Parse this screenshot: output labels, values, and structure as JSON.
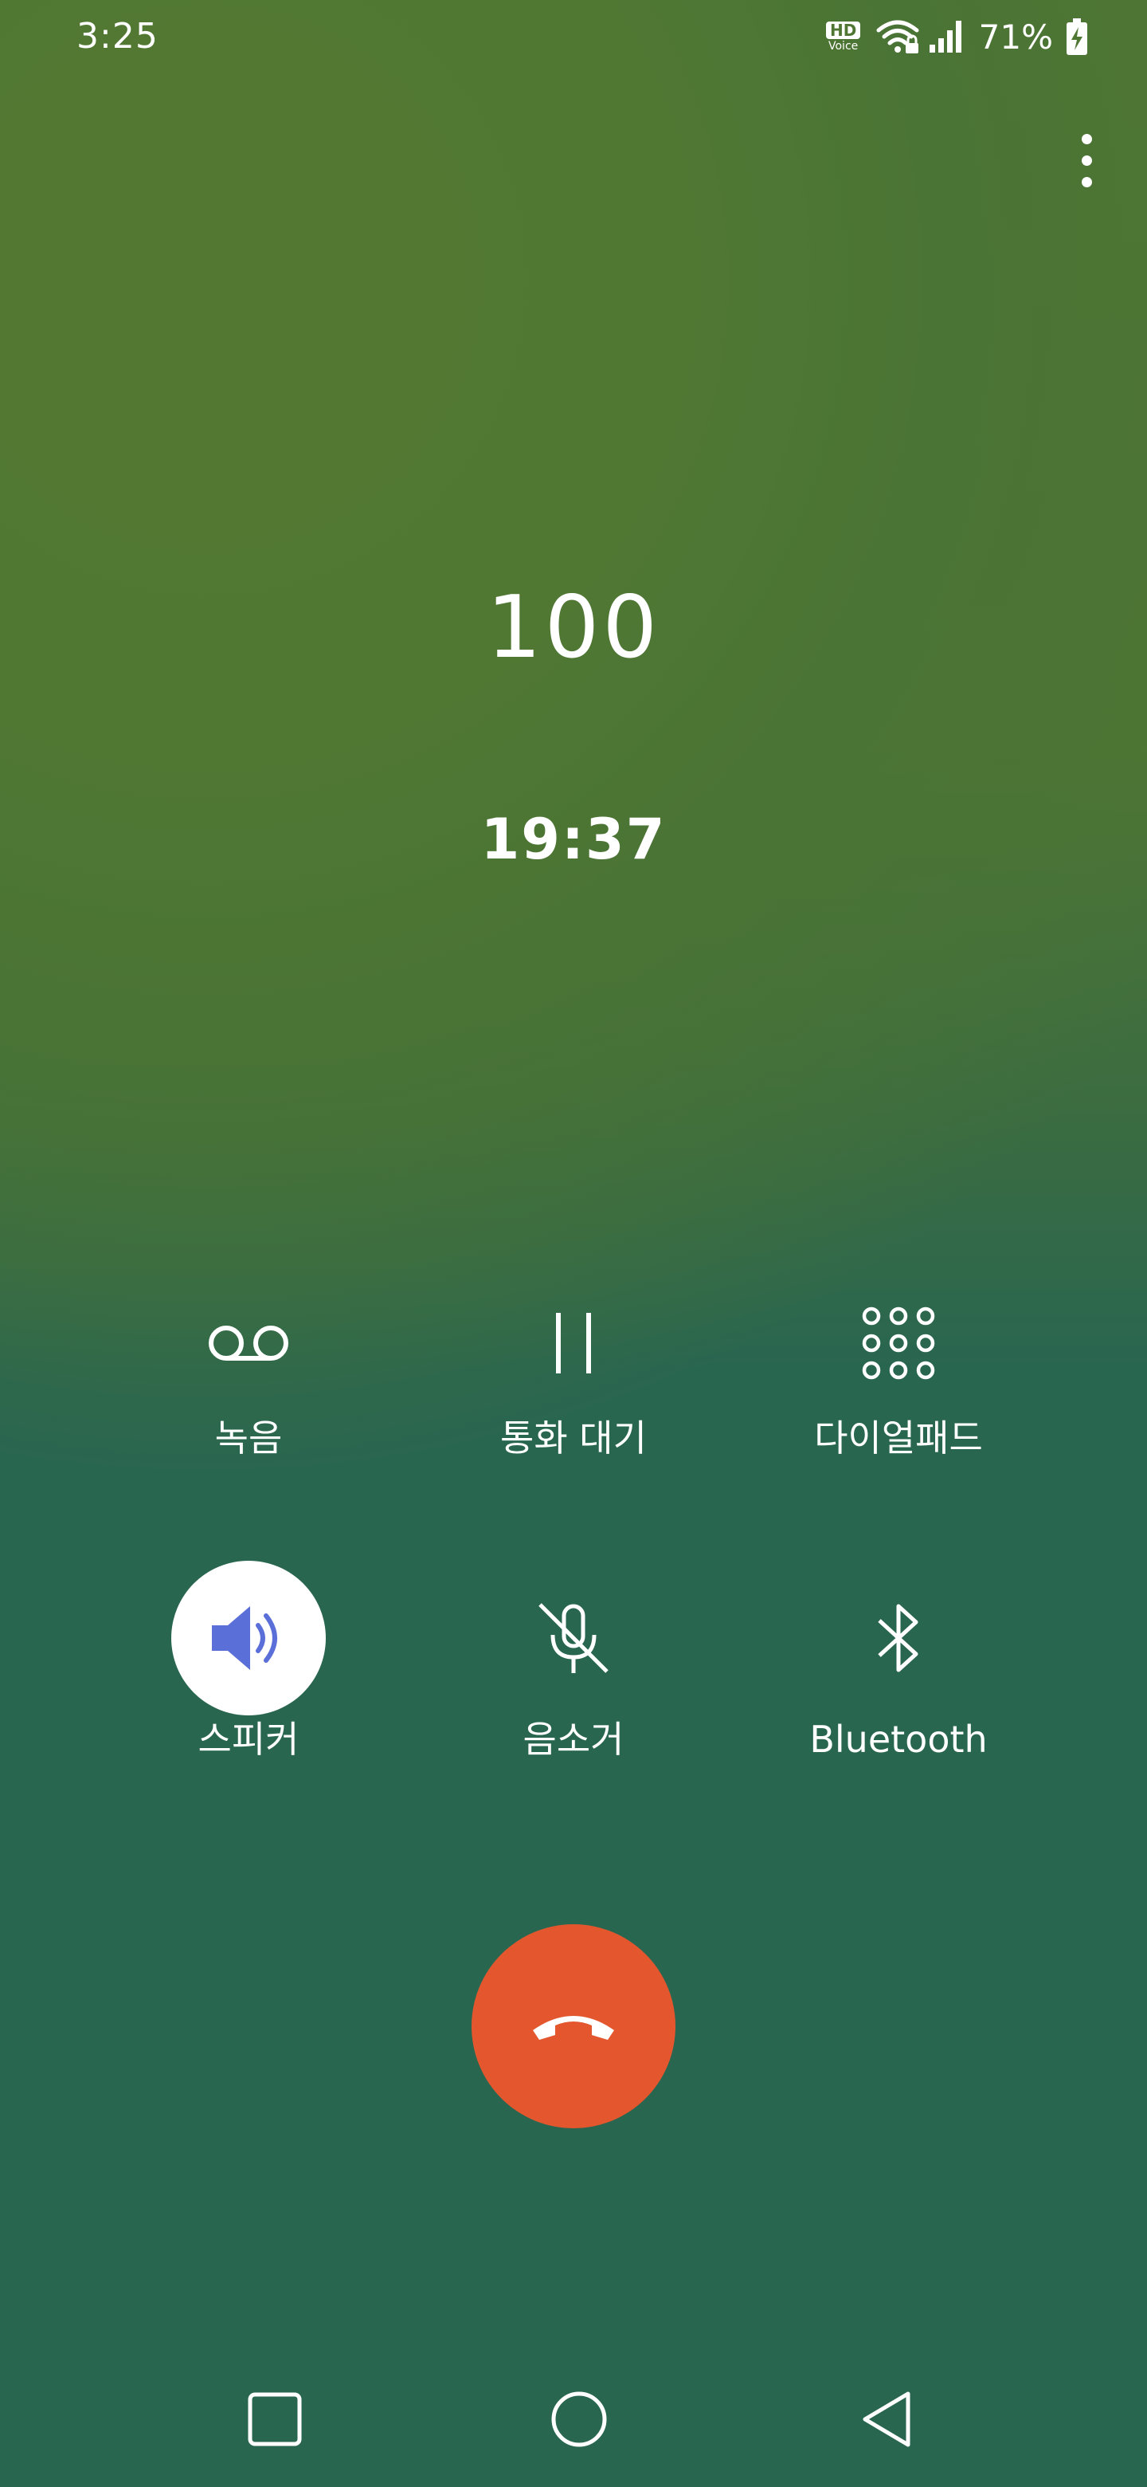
{
  "status_bar": {
    "time": "3:25",
    "hd_badge": "HD",
    "voice_badge": "Voice",
    "battery_percent": "71%"
  },
  "call": {
    "number": "100",
    "duration": "19:37"
  },
  "controls": {
    "record": "녹음",
    "hold": "통화 대기",
    "dialpad": "다이얼패드",
    "speaker": "스피커",
    "mute": "음소거",
    "bluetooth": "Bluetooth"
  },
  "colors": {
    "background_top": "#527832",
    "background_bottom": "#296650",
    "end_call": "#e4572e",
    "speaker_active_icon": "#5b6fd8"
  },
  "icons": {
    "record": "voicemail-icon",
    "hold": "pause-icon",
    "dialpad": "dialpad-icon",
    "speaker": "speaker-icon",
    "mute": "mic-off-icon",
    "bluetooth": "bluetooth-icon",
    "end_call": "call-end-icon"
  }
}
